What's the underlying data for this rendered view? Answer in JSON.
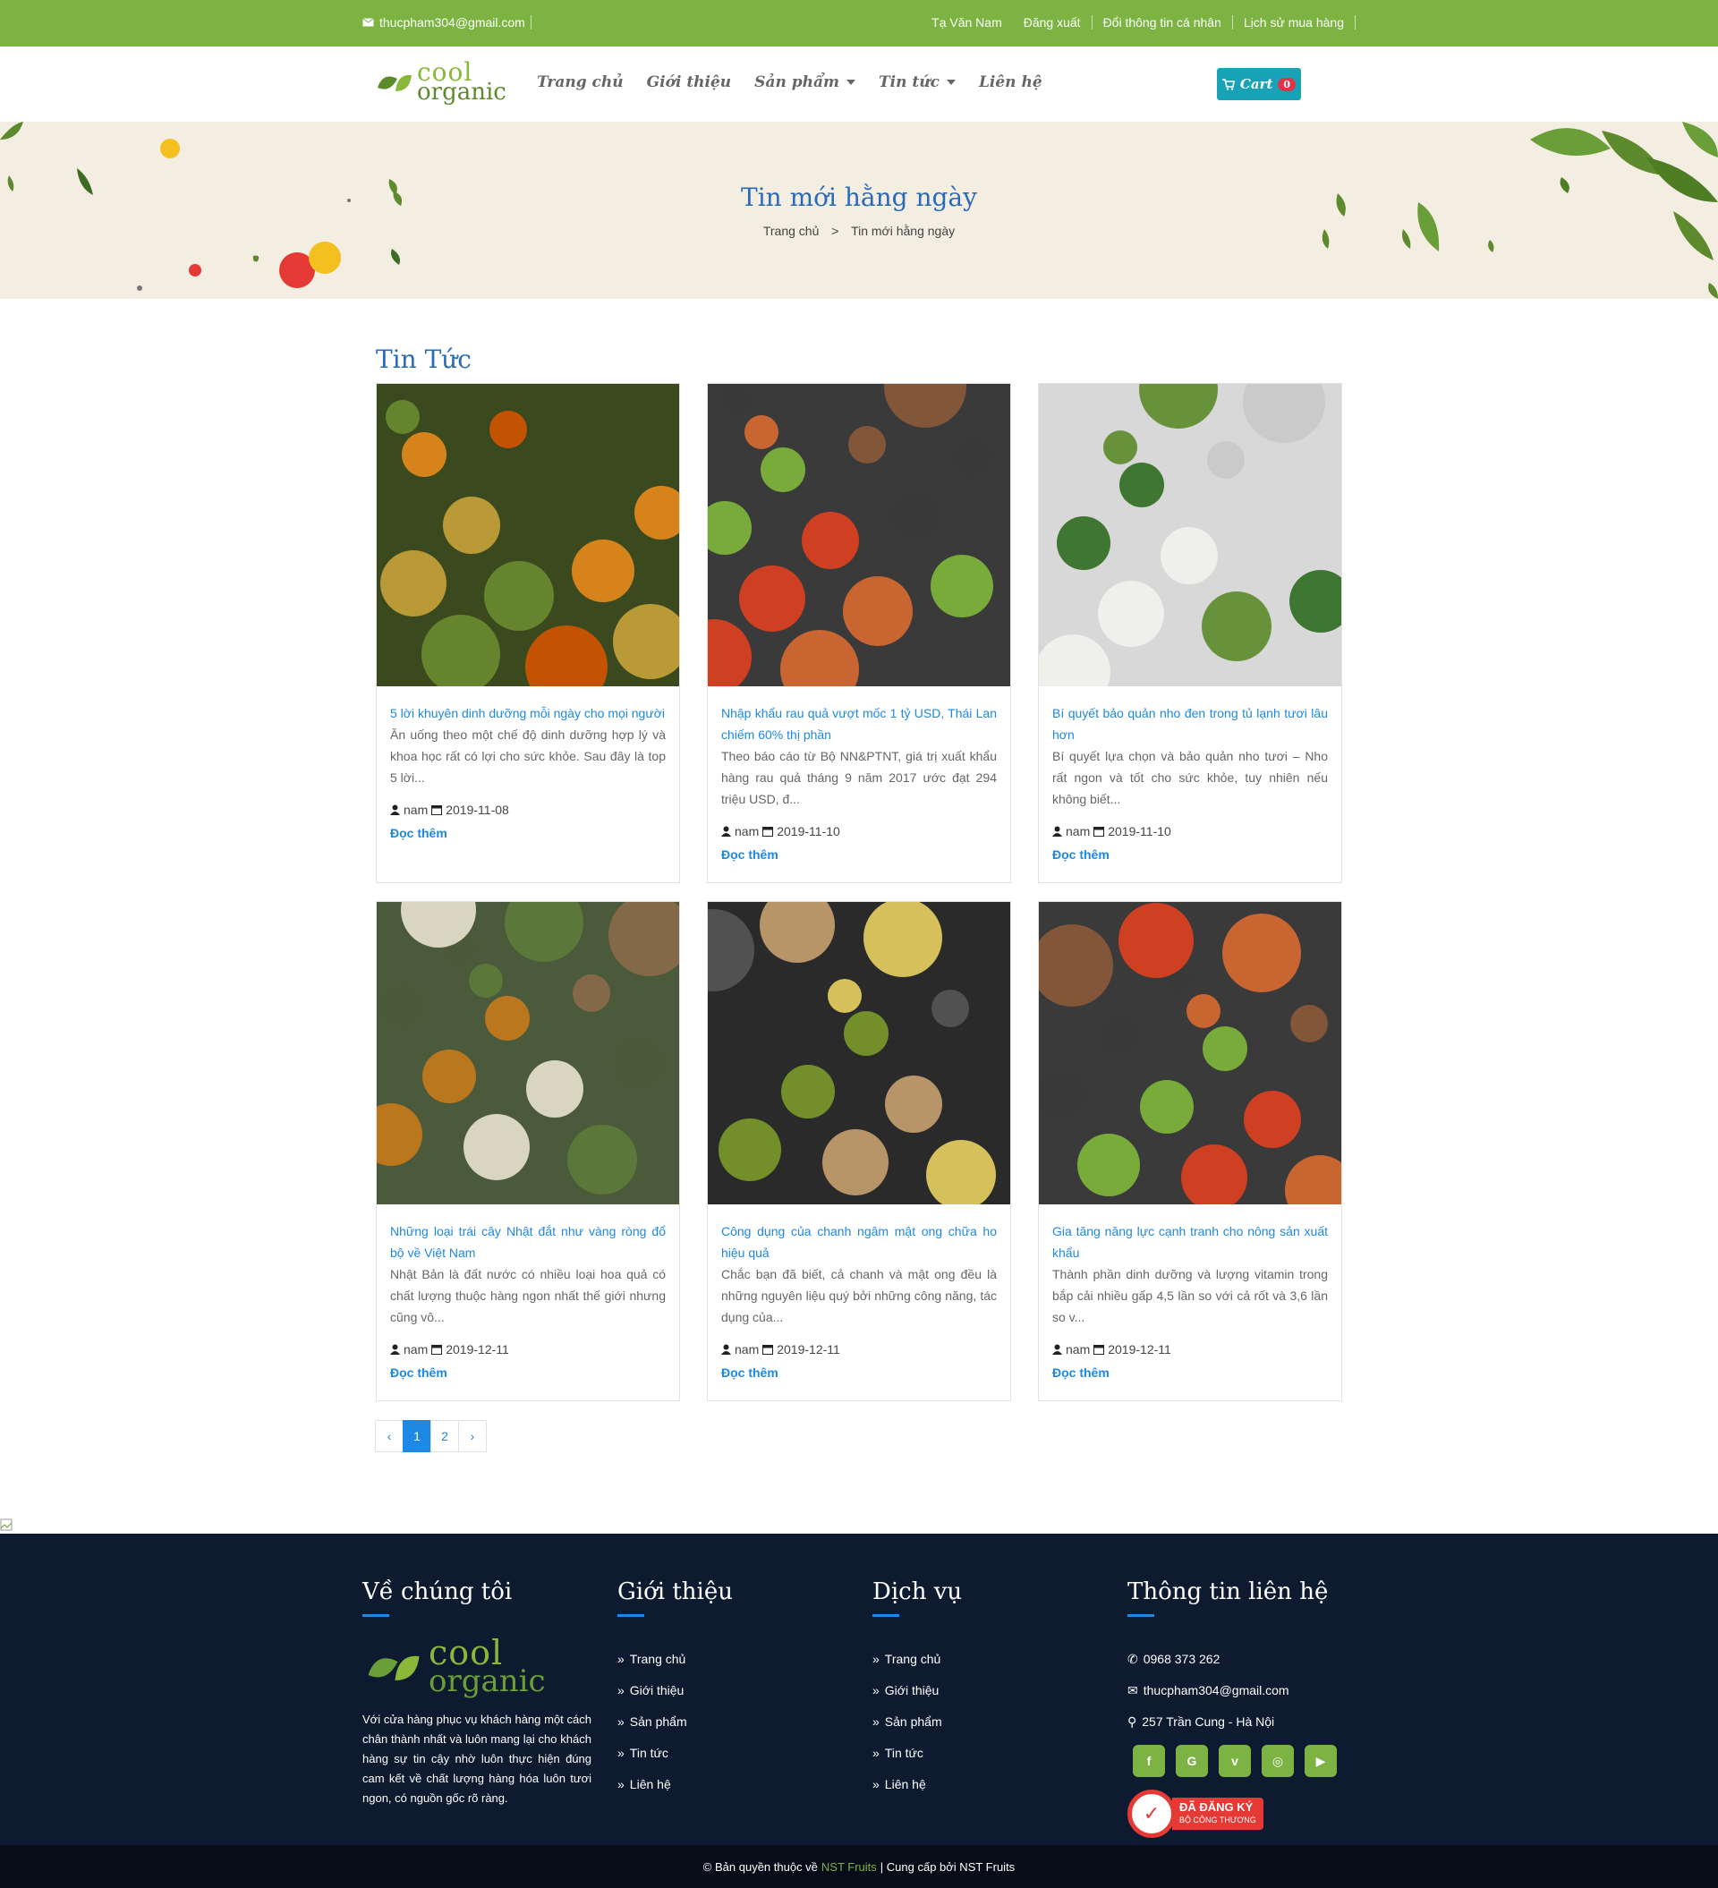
{
  "topbar": {
    "email": "thucpham304@gmail.com",
    "links": [
      "Tạ Văn Nam",
      "Đăng xuất",
      "Đổi thông tin cá nhân",
      "Lịch sử mua hàng"
    ]
  },
  "brand": {
    "logo_line1": "cool",
    "logo_line2": "organic"
  },
  "nav": {
    "items": [
      "Trang chủ",
      "Giới thiệu",
      "Sản phẩm",
      "Tin tức",
      "Liên hệ"
    ]
  },
  "cart": {
    "label": "Cart",
    "count": "0"
  },
  "banner": {
    "title": "Tin mới hằng ngày",
    "crumb_home": "Trang chủ",
    "crumb_sep": ">",
    "crumb_current": "Tin mới hằng ngày"
  },
  "section": {
    "title": "Tin Tức"
  },
  "posts": [
    {
      "title": "5 lời khuyên dinh dưỡng mỗi ngày cho mọi người",
      "desc": "Ăn uống theo một chế độ dinh dưỡng hợp lý và khoa học rất có lợi cho sức khỏe. Sau đây là top 5 lời...",
      "author": "nam",
      "date": "2019-11-08",
      "more": "Đọc thêm"
    },
    {
      "title": "Nhập khẩu rau quả vượt mốc 1 tỷ USD, Thái Lan chiếm 60% thị phần",
      "desc": "Theo báo cáo từ Bộ NN&PTNT, giá trị xuất khẩu hàng rau quả tháng 9 năm 2017 ước đạt 294 triệu USD, đ...",
      "author": "nam",
      "date": "2019-11-10",
      "more": "Đọc thêm"
    },
    {
      "title": "Bí quyết bảo quản nho đen trong tủ lạnh tươi lâu hơn",
      "desc": "Bí quyết lựa chọn và bảo quản nho tươi – Nho rất ngon và tốt cho sức khỏe, tuy nhiên nếu không biết...",
      "author": "nam",
      "date": "2019-11-10",
      "more": "Đọc thêm"
    },
    {
      "title": "Những loại trái cây Nhật đắt như vàng ròng đổ bộ về Việt Nam",
      "desc": "Nhật Bản là đất nước có nhiều loại hoa quả có chất lượng thuộc hàng ngon nhất thế giới nhưng cũng vô...",
      "author": "nam",
      "date": "2019-12-11",
      "more": "Đọc thêm"
    },
    {
      "title": "Công dụng của chanh ngâm mật ong chữa ho hiệu quả",
      "desc": "Chắc bạn đã biết, cả chanh và mật ong đều là những nguyên liệu quý bởi những công năng, tác dụng của...",
      "author": "nam",
      "date": "2019-12-11",
      "more": "Đọc thêm"
    },
    {
      "title": "Gia tăng năng lực cạnh tranh cho nông sản xuất khẩu",
      "desc": "Thành phần dinh dưỡng và lượng vitamin trong bắp cải nhiều gấp 4,5 lần so với cả rốt và 3,6 lần so v...",
      "author": "nam",
      "date": "2019-12-11",
      "more": "Đọc thêm"
    }
  ],
  "pagination": {
    "prev": "‹",
    "pages": [
      "1",
      "2"
    ],
    "next": "›",
    "active": "1"
  },
  "footer": {
    "about": {
      "title": "Về chúng tôi",
      "desc": "Với cửa hàng phục vụ khách hàng một cách chân thành nhất và luôn mang lại cho khách hàng sự tin cậy nhờ luôn thực hiện đúng cam kết về chất lượng hàng hóa luôn tươi ngon, có nguồn gốc rõ ràng."
    },
    "intro": {
      "title": "Giới thiệu",
      "items": [
        "Trang chủ",
        "Giới thiệu",
        "Sản phẩm",
        "Tin tức",
        "Liên hệ"
      ]
    },
    "service": {
      "title": "Dịch vụ",
      "items": [
        "Trang chủ",
        "Giới thiệu",
        "Sản phẩm",
        "Tin tức",
        "Liên hệ"
      ]
    },
    "contact": {
      "title": "Thông tin liên hệ",
      "phone": "0968 373 262",
      "email": "thucpham304@gmail.com",
      "address": "257 Trần Cung - Hà Nội",
      "registered": "ĐÃ ĐĂNG KÝ",
      "registered_sub": "BỘ CÔNG THƯƠNG"
    },
    "social_icons": [
      "facebook-icon",
      "google-icon",
      "vimeo-icon",
      "instagram-icon",
      "youtube-icon"
    ]
  },
  "copyright": {
    "prefix": "© Bản quyền thuộc về",
    "brand": "NST Fruits",
    "suffix": "| Cung cấp bởi NST Fruits"
  },
  "colors": {
    "green": "#7cb342",
    "blue": "#1e88e5",
    "title_blue": "#2a6bb8",
    "footer_bg": "#0d1a2f",
    "cart": "#17a2b8"
  }
}
